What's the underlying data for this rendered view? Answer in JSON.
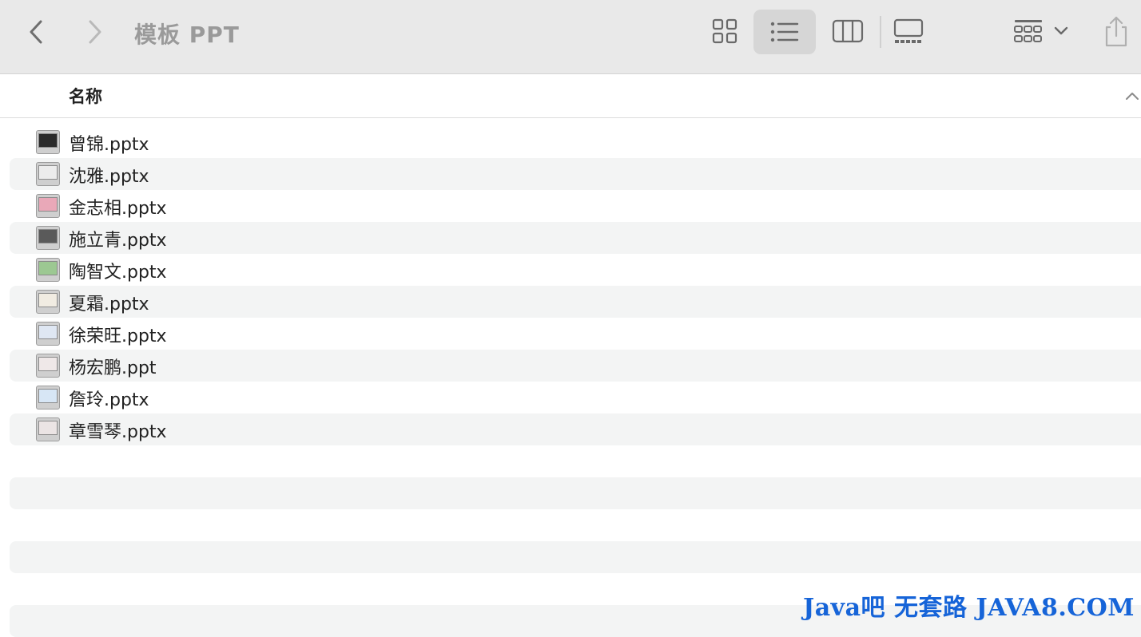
{
  "window": {
    "title": "模板 PPT"
  },
  "columns": {
    "name": "名称"
  },
  "files": [
    {
      "name": "曾锦.pptx",
      "icon": "dark-slide-icon",
      "thumb": "#2b2b2b"
    },
    {
      "name": "沈雅.pptx",
      "icon": "light-slide-icon",
      "thumb": "#ececec"
    },
    {
      "name": "金志相.pptx",
      "icon": "pink-slide-icon",
      "thumb": "#e9a8b8"
    },
    {
      "name": "施立青.pptx",
      "icon": "dark-slide-icon",
      "thumb": "#5a5a5a"
    },
    {
      "name": "陶智文.pptx",
      "icon": "green-slide-icon",
      "thumb": "#9cc892"
    },
    {
      "name": "夏霜.pptx",
      "icon": "light-slide-icon",
      "thumb": "#f1ece2"
    },
    {
      "name": "徐荣旺.pptx",
      "icon": "blue-slide-icon",
      "thumb": "#dfe7f3"
    },
    {
      "name": "杨宏鹏.ppt",
      "icon": "light-slide-icon",
      "thumb": "#efe8e8"
    },
    {
      "name": "詹玲.pptx",
      "icon": "blue-slide-icon",
      "thumb": "#d7e6f5"
    },
    {
      "name": "章雪琴.pptx",
      "icon": "light-slide-icon",
      "thumb": "#ebe4e4"
    }
  ],
  "watermark": "Java吧 无套路 JAVA8.COM"
}
